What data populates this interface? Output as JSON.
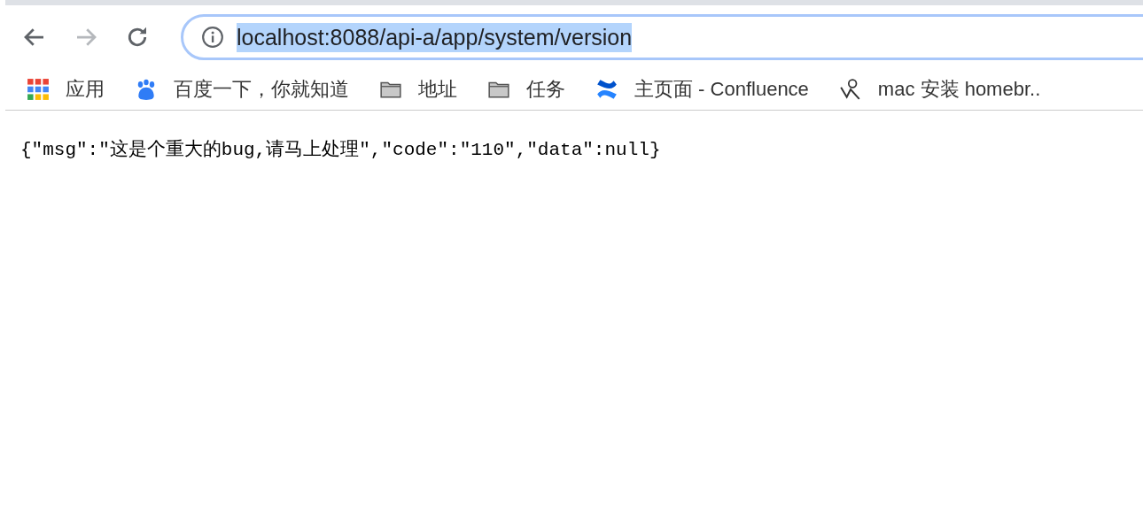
{
  "toolbar": {
    "buttons": [
      {
        "kind": "back",
        "disabled": false
      },
      {
        "kind": "forward",
        "disabled": true
      },
      {
        "kind": "reload",
        "disabled": false
      }
    ],
    "address_bar": {
      "url": "localhost:8088/api-a/app/system/version",
      "selected": true
    }
  },
  "bookmarks": [
    {
      "kind": "apps",
      "label": "应用"
    },
    {
      "kind": "paw",
      "label": "百度一下，你就知道"
    },
    {
      "kind": "folder",
      "label": "地址"
    },
    {
      "kind": "folder",
      "label": "任务"
    },
    {
      "kind": "confluence",
      "label": "主页面 - Confluence"
    },
    {
      "kind": "figure",
      "label": "mac 安装 homebr.."
    }
  ],
  "content": {
    "text": "{\"msg\":\"这是个重大的bug,请马上处理\",\"code\":\"110\",\"data\":null}"
  }
}
